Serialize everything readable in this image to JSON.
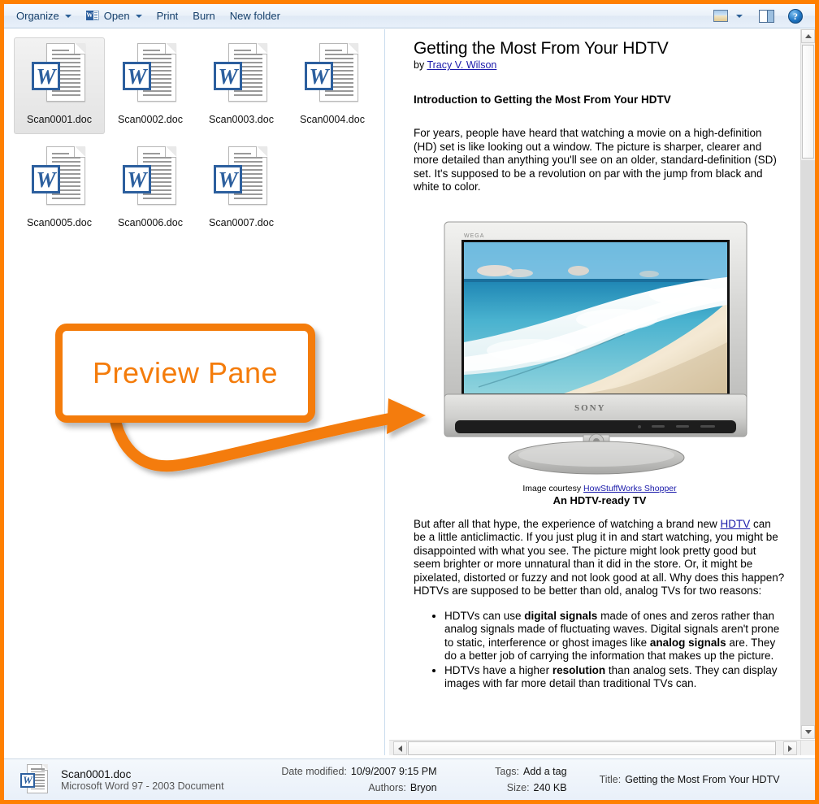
{
  "window": {
    "accent_color": "#FF8000",
    "callout_color": "#F47C0B"
  },
  "toolbar": {
    "organize_label": "Organize",
    "open_label": "Open",
    "print_label": "Print",
    "burn_label": "Burn",
    "new_folder_label": "New folder",
    "word_badge": "W",
    "help_glyph": "?",
    "icons": {
      "views": "views-icon",
      "preview_pane": "preview-pane-icon",
      "help": "help-icon",
      "dropdown": "chevron-down-icon"
    }
  },
  "files": {
    "items": [
      {
        "name": "Scan0001.doc",
        "selected": true
      },
      {
        "name": "Scan0002.doc",
        "selected": false
      },
      {
        "name": "Scan0003.doc",
        "selected": false
      },
      {
        "name": "Scan0004.doc",
        "selected": false
      },
      {
        "name": "Scan0005.doc",
        "selected": false
      },
      {
        "name": "Scan0006.doc",
        "selected": false
      },
      {
        "name": "Scan0007.doc",
        "selected": false
      }
    ],
    "icon_badge": "W"
  },
  "annotation": {
    "label": "Preview Pane"
  },
  "preview": {
    "title": "Getting the Most From Your HDTV",
    "byline_prefix": "by ",
    "author": "Tracy V. Wilson",
    "heading": "Introduction to Getting the Most From Your HDTV",
    "paragraph1": "For years, people have heard that watching a movie on a high-definition (HD) set is like looking out a window. The picture is sharper, clearer and more detailed than anything you'll see on an older, standard-definition (SD) set. It's supposed to be a revolution on par with the jump from black and white to color.",
    "image_courtesy_prefix": "Image courtesy ",
    "image_courtesy_link": "HowStuffWorks Shopper",
    "image_caption": "An HDTV-ready TV",
    "tv_brand": "SONY",
    "tv_model_badge": "WEGA",
    "paragraph2_a": "But after all that hype, the experience of watching a brand new ",
    "paragraph2_link": "HDTV",
    "paragraph2_b": " can be a little anticlimactic. If you just plug it in and start watching, you might be disappointed with what you see. The picture might look pretty good but seem brighter or more unnatural than it did in the store. Or, it might be pixelated, distorted or fuzzy and not look good at all. Why does this happen? HDTVs are supposed to be better than old, analog TVs for two reasons:",
    "bullets": [
      {
        "parts": [
          {
            "text": "HDTVs can use ",
            "bold": false
          },
          {
            "text": "digital signals",
            "bold": true
          },
          {
            "text": " made of ones and zeros rather than analog signals made of fluctuating waves. Digital signals aren't prone to static, interference or ghost images like ",
            "bold": false
          },
          {
            "text": "analog signals",
            "bold": true
          },
          {
            "text": " are. They do a better job of carrying the information that makes up the picture.",
            "bold": false
          }
        ]
      },
      {
        "parts": [
          {
            "text": "HDTVs have a higher ",
            "bold": false
          },
          {
            "text": "resolution",
            "bold": true
          },
          {
            "text": " than analog sets. They can display images with far more detail than traditional TVs can.",
            "bold": false
          }
        ]
      }
    ]
  },
  "statusbar": {
    "file_name": "Scan0001.doc",
    "file_type": "Microsoft Word 97 - 2003 Document",
    "date_modified_label": "Date modified:",
    "date_modified_value": "10/9/2007 9:15 PM",
    "authors_label": "Authors:",
    "authors_value": "Bryon",
    "tags_label": "Tags:",
    "tags_value": "Add a tag",
    "size_label": "Size:",
    "size_value": "240 KB",
    "title_label": "Title:",
    "title_value": "Getting the Most From Your HDTV",
    "icon_badge": "W"
  }
}
